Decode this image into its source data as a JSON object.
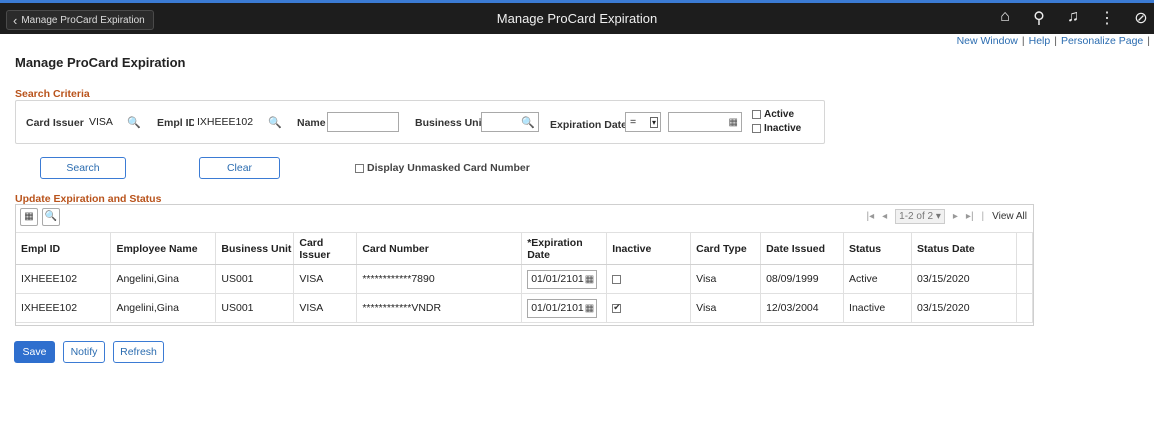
{
  "banner": {
    "back_label": "Manage ProCard Expiration",
    "title": "Manage ProCard Expiration"
  },
  "top_links": [
    "New Window",
    "Help",
    "Personalize Page"
  ],
  "page_title": "Manage ProCard Expiration",
  "search_criteria": {
    "section_label": "Search Criteria",
    "card_issuer_label": "Card Issuer",
    "card_issuer_value": "VISA",
    "empl_id_label": "Empl ID",
    "empl_id_value": "IXHEEE102",
    "name_label": "Name",
    "name_value": "",
    "business_unit_label": "Business Unit",
    "business_unit_value": "",
    "expiration_date_label": "Expiration Date",
    "operator_value": "=",
    "expiration_date_value": "",
    "active_label": "Active",
    "inactive_label": "Inactive"
  },
  "buttons": {
    "search": "Search",
    "clear": "Clear",
    "display_unmasked": "Display Unmasked Card Number",
    "save": "Save",
    "notify": "Notify",
    "refresh": "Refresh"
  },
  "grid": {
    "section_label": "Update Expiration and Status",
    "pager_count": "1-2 of 2",
    "view_all": "View All",
    "columns": [
      "Empl ID",
      "Employee Name",
      "Business Unit",
      "Card Issuer",
      "Card Number",
      "*Expiration Date",
      "Inactive",
      "Card Type",
      "Date Issued",
      "Status",
      "Status Date"
    ],
    "rows": [
      {
        "empl_id": "IXHEEE102",
        "name": "Angelini,Gina",
        "bu": "US001",
        "issuer": "VISA",
        "card_number": "************7890",
        "exp_date": "01/01/2101",
        "inactive": false,
        "card_type": "Visa",
        "date_issued": "08/09/1999",
        "status": "Active",
        "status_date": "03/15/2020"
      },
      {
        "empl_id": "IXHEEE102",
        "name": "Angelini,Gina",
        "bu": "US001",
        "issuer": "VISA",
        "card_number": "************VNDR",
        "exp_date": "01/01/2101",
        "inactive": true,
        "card_type": "Visa",
        "date_issued": "12/03/2004",
        "status": "Inactive",
        "status_date": "03/15/2020"
      }
    ]
  },
  "colors": {
    "accent": "#2f6fce",
    "section_label": "#b9531b",
    "banner": "#1d1d1d"
  }
}
